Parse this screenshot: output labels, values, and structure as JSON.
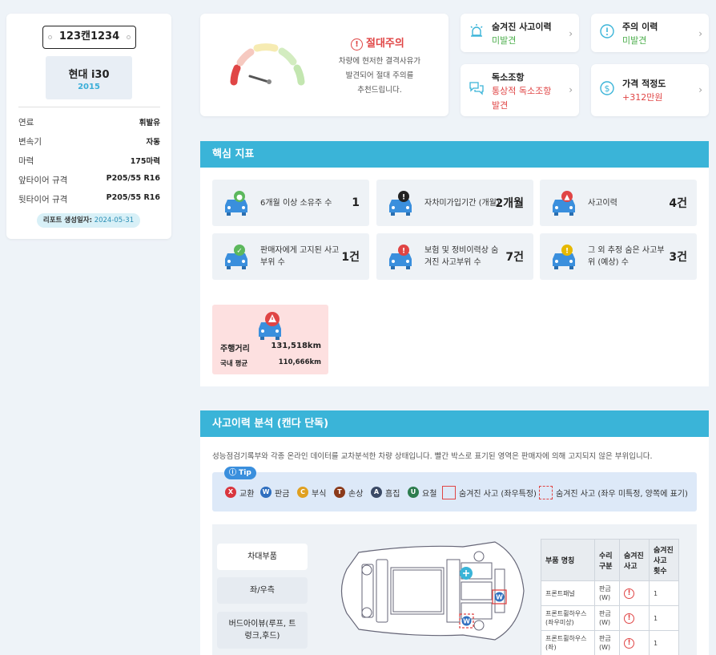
{
  "vehicle": {
    "plate": "123캔1234",
    "model": "현대 i30",
    "year": "2015",
    "specs": [
      {
        "label": "연료",
        "value": "휘발유"
      },
      {
        "label": "변속기",
        "value": "자동"
      },
      {
        "label": "마력",
        "value": "175마력"
      },
      {
        "label": "앞타이어 규격",
        "value": "P205/55 R16"
      },
      {
        "label": "뒷타이어 규격",
        "value": "P205/55 R16"
      }
    ],
    "report_label": "리포트 생성일자:",
    "report_date": "2024-05-31"
  },
  "gauge": {
    "title": "절대주의",
    "desc_lines": [
      "차량에 현저한 결격사유가",
      "발견되어 절대 주의를",
      "추천드립니다."
    ],
    "level": "danger"
  },
  "summary_cards": [
    {
      "title": "숨겨진 사고이력",
      "status": "미발견",
      "status_color": "#4cae4c",
      "icon": "siren-icon"
    },
    {
      "title": "주의 이력",
      "status": "미발견",
      "status_color": "#4cae4c",
      "icon": "alert-circle-icon"
    },
    {
      "title": "독소조항",
      "status_lines": [
        "통상적 독소조항",
        "발견"
      ],
      "status_color": "#e04545",
      "icon": "chat-icon"
    },
    {
      "title": "가격 적정도",
      "status": "+312만원",
      "status_color": "#e04545",
      "icon": "dollar-icon"
    }
  ],
  "core": {
    "title": "핵심 지표",
    "indicators": [
      {
        "label": "6개월 이상 소유주 수",
        "value": "1",
        "badge": "#5cb85c",
        "badge_icon": "person"
      },
      {
        "label": "자차미가입기간 (개월)",
        "value": "2개월",
        "badge": "#222222",
        "badge_icon": "exclaim"
      },
      {
        "label": "사고이력",
        "value": "4건",
        "badge": "#e04545",
        "badge_icon": "car"
      },
      {
        "label": "판매자에게 고지된 사고부위 수",
        "value": "1건",
        "badge": "#5cb85c",
        "badge_icon": "check"
      },
      {
        "label": "보험 및 정비이력상 숨겨진 사고부위 수",
        "value": "7건",
        "badge": "#e04545",
        "badge_icon": "warn"
      },
      {
        "label": "그 외 추정 숨은 사고부위 (예상) 수",
        "value": "3건",
        "badge": "#e6b800",
        "badge_icon": "exclaim"
      }
    ],
    "mileage": {
      "label": "주행거리",
      "value": "131,518km",
      "avg_label": "국내 평균",
      "avg_value": "110,666km"
    }
  },
  "accident": {
    "title": "사고이력 분석 (캔다 단독)",
    "description": "성능점검기록부와 각종 온라인 데이터를 교차분석한 차량 상태입니다. 빨간 박스로 표기된 영역은 판매자에 의해 고지되지 않은 부위입니다.",
    "tip": "Tip",
    "legend": [
      {
        "code": "X",
        "label": "교환",
        "color": "#d9363e"
      },
      {
        "code": "W",
        "label": "판금",
        "color": "#2f6fbf"
      },
      {
        "code": "C",
        "label": "부식",
        "color": "#e0a020"
      },
      {
        "code": "T",
        "label": "손상",
        "color": "#8b3a1a"
      },
      {
        "code": "A",
        "label": "흠집",
        "color": "#3b4a66"
      },
      {
        "code": "U",
        "label": "요철",
        "color": "#2e7d4f"
      }
    ],
    "legend_box1": "숨겨진 사고 (좌우특정)",
    "legend_box2": "숨겨진 사고 (좌우 미특정, 양쪽에 표기)",
    "buttons": [
      "차대부품",
      "좌/우측",
      "버드아이뷰(루프, 트렁크,후드)"
    ],
    "table": {
      "headers": [
        "부품 명칭",
        "수리 구분",
        "숨겨진 사고",
        "숨겨진 사고 횟수"
      ],
      "rows": [
        {
          "part": "프론트패널",
          "repair": "판금 (W)",
          "count": "1"
        },
        {
          "part": "프론트휠하우스 (좌우미상)",
          "repair": "판금 (W)",
          "count": "1"
        },
        {
          "part": "프론트휠하우스 (좌)",
          "repair": "판금 (W)",
          "count": "1"
        }
      ]
    }
  }
}
